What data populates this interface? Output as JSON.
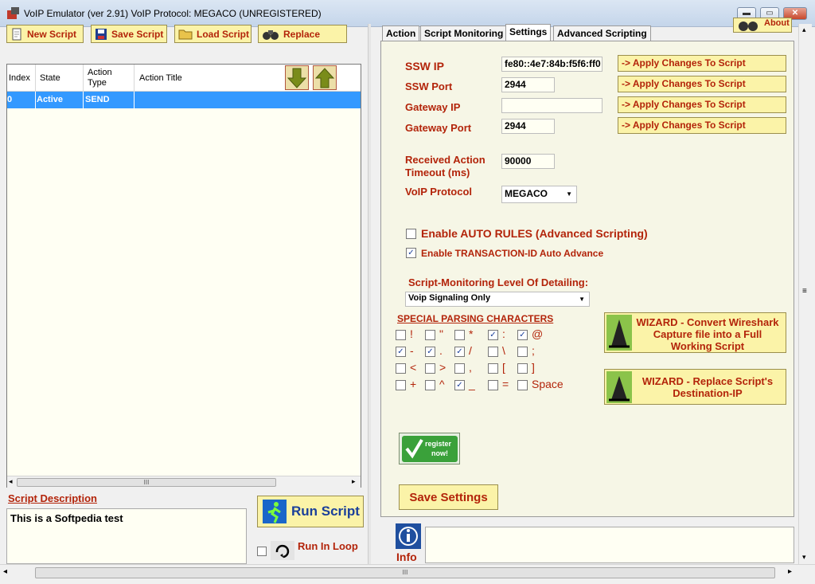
{
  "window": {
    "title": "VoIP Emulator  (ver 2.91)      VoIP Protocol: MEGACO  (UNREGISTERED)",
    "min": "▬",
    "max": "▭",
    "close": "✕"
  },
  "toolbar": {
    "new_script": "New Script",
    "save_script": "Save Script",
    "load_script": "Load Script",
    "replace": "Replace"
  },
  "grid": {
    "columns": [
      "Index",
      "State",
      "Action Type",
      "Action Title"
    ],
    "rows": [
      {
        "index": "0",
        "state": "Active",
        "type": "SEND",
        "title": ""
      }
    ]
  },
  "description": {
    "title": "Script Description",
    "text": "This is a Softpedia test"
  },
  "run": {
    "run_label": "Run Script",
    "loop_label": "Run In Loop"
  },
  "tabs": [
    "Action",
    "Script Monitoring",
    "Settings",
    "Advanced Scripting"
  ],
  "about": "About",
  "settings": {
    "ssw_ip_label": "SSW IP",
    "ssw_ip": "fe80::4e7:84b:f5f6:ff0",
    "ssw_port_label": "SSW Port",
    "ssw_port": "2944",
    "gateway_ip_label": "Gateway IP",
    "gateway_ip": "",
    "gateway_port_label": "Gateway Port",
    "gateway_port": "2944",
    "apply_label": "->   Apply Changes To Script",
    "timeout_label_1": "Received Action",
    "timeout_label_2": "Timeout (ms)",
    "timeout": "90000",
    "protocol_label": "VoIP Protocol",
    "protocol": "MEGACO",
    "auto_rules": "Enable AUTO RULES (Advanced Scripting)",
    "auto_rules_checked": false,
    "txid_auto": "Enable TRANSACTION-ID Auto Advance",
    "txid_auto_checked": true,
    "monitor_level_label": "Script-Monitoring Level Of Detailing:",
    "monitor_level": "Voip Signaling Only",
    "special_chars_title": "SPECIAL PARSING CHARACTERS",
    "special_chars": [
      {
        "c": "!",
        "checked": false
      },
      {
        "c": "\"",
        "checked": false
      },
      {
        "c": "*",
        "checked": false
      },
      {
        "c": ":",
        "checked": true
      },
      {
        "c": "@",
        "checked": true
      },
      {
        "c": "-",
        "checked": true
      },
      {
        "c": ".",
        "checked": true
      },
      {
        "c": "/",
        "checked": true
      },
      {
        "c": "\\",
        "checked": false
      },
      {
        "c": ";",
        "checked": false
      },
      {
        "c": "<",
        "checked": false
      },
      {
        "c": ">",
        "checked": false
      },
      {
        "c": ",",
        "checked": false
      },
      {
        "c": "[",
        "checked": false
      },
      {
        "c": "]",
        "checked": false
      },
      {
        "c": "+",
        "checked": false
      },
      {
        "c": "^",
        "checked": false
      },
      {
        "c": "_",
        "checked": true
      },
      {
        "c": "=",
        "checked": false
      },
      {
        "c": "Space",
        "checked": false
      }
    ],
    "wizard1": [
      "WIZARD - Convert Wireshark",
      "Capture file into a Full",
      "Working Script"
    ],
    "wizard2": [
      "WIZARD -  Replace Script's",
      "Destination-IP"
    ],
    "register_1": "register",
    "register_2": "now!",
    "save_settings": "Save Settings"
  },
  "info_label": "Info",
  "scroll_grip": "III",
  "colors": {
    "accent_red": "#b3240a",
    "button_yellow": "#fbf3a8",
    "selection_blue": "#3399ff"
  }
}
